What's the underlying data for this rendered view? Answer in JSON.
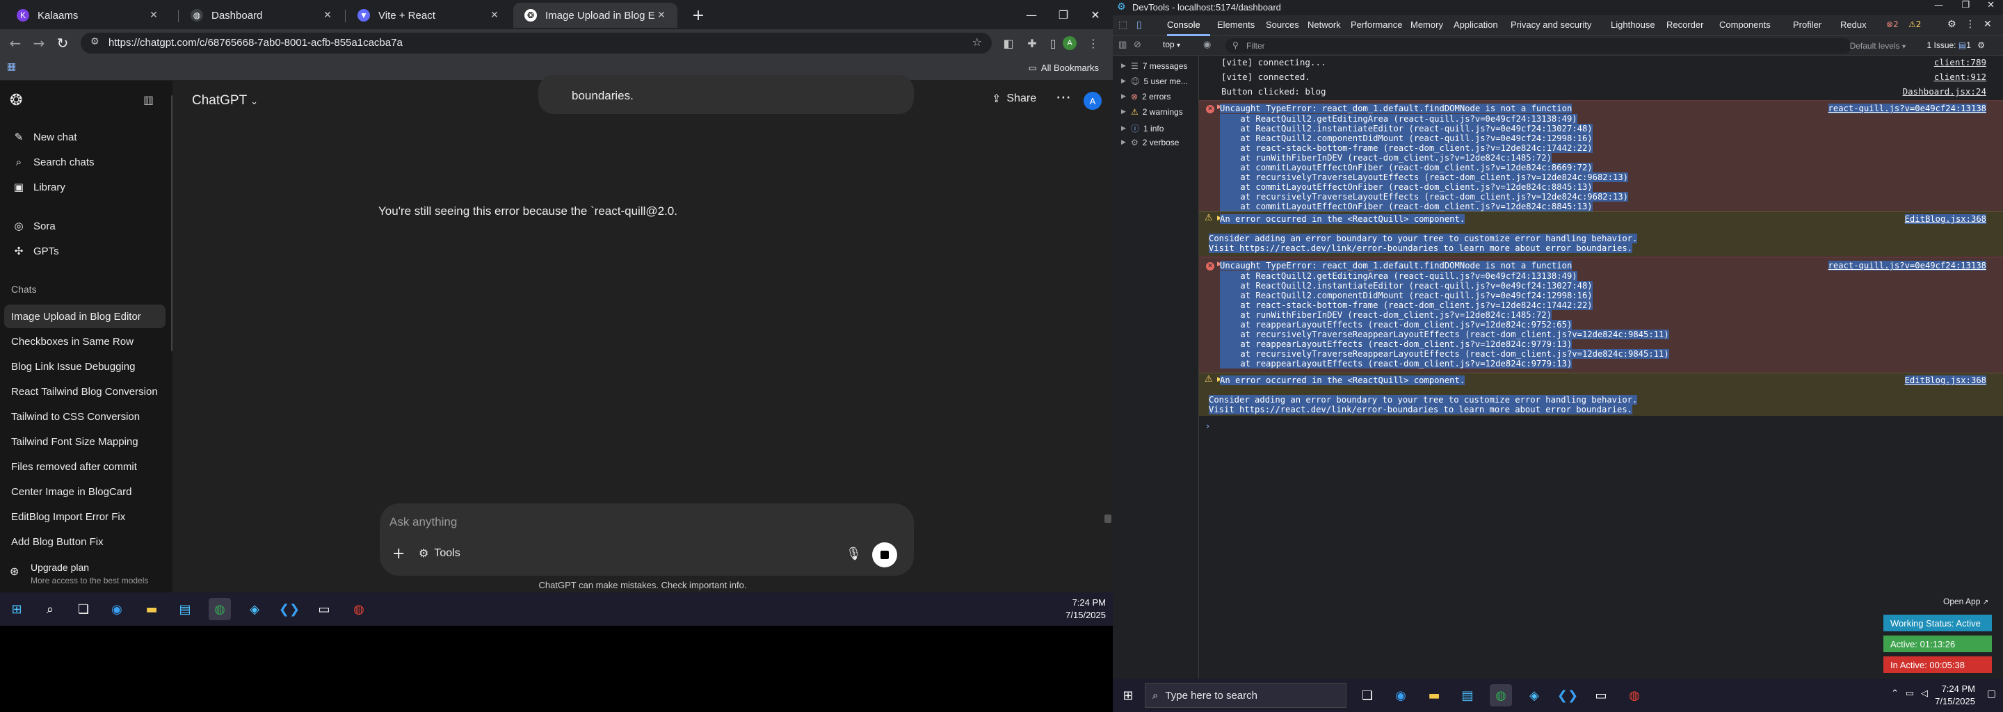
{
  "browser": {
    "tabs": [
      {
        "label": "Kalaams",
        "active": false
      },
      {
        "label": "Dashboard",
        "active": false
      },
      {
        "label": "Vite + React",
        "active": false
      },
      {
        "label": "Image Upload in Blog Editor",
        "active": true
      }
    ],
    "url": "https://chatgpt.com/c/68765668-7ab0-8001-acfb-855a1cacba7a",
    "all_bookmarks": "All Bookmarks"
  },
  "chatgpt": {
    "title": "ChatGPT",
    "share": "Share",
    "avatar_initial": "A",
    "sidebar": {
      "new_chat": "New chat",
      "search_chats": "Search chats",
      "library": "Library",
      "sora": "Sora",
      "gpts": "GPTs",
      "chats_label": "Chats",
      "chats": [
        "Image Upload in Blog Editor",
        "Checkboxes in Same Row",
        "Blog Link Issue Debugging",
        "React Tailwind Blog Conversion",
        "Tailwind to CSS Conversion",
        "Tailwind Font Size Mapping",
        "Files removed after commit",
        "Center Image in BlogCard",
        "EditBlog Import Error Fix",
        "Add Blog Button Fix"
      ],
      "upgrade_title": "Upgrade plan",
      "upgrade_sub": "More access to the best models"
    },
    "bubble_text": "boundaries.",
    "assistant_text": "You're still seeing this error because the `react-quill@2.0.",
    "composer": {
      "placeholder": "Ask anything",
      "tools": "Tools"
    },
    "disclaimer": "ChatGPT can make mistakes. Check important info."
  },
  "taskbar_left": {
    "time": "7:24 PM",
    "date": "7/15/2025"
  },
  "devtools": {
    "window_title": "DevTools - localhost:5174/dashboard",
    "tabs": [
      "Console",
      "Elements",
      "Sources",
      "Network",
      "Performance",
      "Memory",
      "Application",
      "Privacy and security",
      "Lighthouse",
      "Recorder",
      "Components",
      "Profiler",
      "Redux"
    ],
    "active_tab": "Console",
    "badge_errors": "2",
    "badge_warnings": "2",
    "context": "top",
    "filter_placeholder": "Filter",
    "levels": "Default levels",
    "issues": "1 Issue:",
    "issues_count": "1",
    "sidebar": [
      {
        "label": "7 messages",
        "icon": "list-icon"
      },
      {
        "label": "5 user me...",
        "icon": "user-icon"
      },
      {
        "label": "2 errors",
        "icon": "error-icon"
      },
      {
        "label": "2 warnings",
        "icon": "warning-icon"
      },
      {
        "label": "1 info",
        "icon": "info-icon"
      },
      {
        "label": "2 verbose",
        "icon": "verbose-icon"
      }
    ],
    "logs": [
      {
        "text": "[vite] connecting...",
        "src": "client:789"
      },
      {
        "text": "[vite] connected.",
        "src": "client:912"
      },
      {
        "text": "Button clicked: blog",
        "src": "Dashboard.jsx:24"
      }
    ],
    "error1": {
      "src": "react-quill.js?v=0e49cf24:13138",
      "lines": [
        "Uncaught TypeError: react_dom_1.default.findDOMNode is not a function",
        "    at ReactQuill2.getEditingArea (react-quill.js?v=0e49cf24:13138:49)",
        "    at ReactQuill2.instantiateEditor (react-quill.js?v=0e49cf24:13027:48)",
        "    at ReactQuill2.componentDidMount (react-quill.js?v=0e49cf24:12998:16)",
        "    at react-stack-bottom-frame (react-dom_client.js?v=12de824c:17442:22)",
        "    at runWithFiberInDEV (react-dom_client.js?v=12de824c:1485:72)",
        "    at commitLayoutEffectOnFiber (react-dom_client.js?v=12de824c:8669:72)",
        "    at recursivelyTraverseLayoutEffects (react-dom_client.js?v=12de824c:9682:13)",
        "    at commitLayoutEffectOnFiber (react-dom_client.js?v=12de824c:8845:13)",
        "    at recursivelyTraverseLayoutEffects (react-dom_client.js?v=12de824c:9682:13)",
        "    at commitLayoutEffectOnFiber (react-dom_client.js?v=12de824c:8845:13)"
      ]
    },
    "warn1": {
      "src": "EditBlog.jsx:368",
      "lines": [
        "An error occurred in the <ReactQuill> component.",
        "",
        "Consider adding an error boundary to your tree to customize error handling behavior.",
        "Visit https://react.dev/link/error-boundaries to learn more about error boundaries."
      ]
    },
    "error2": {
      "src": "react-quill.js?v=0e49cf24:13138",
      "lines": [
        "Uncaught TypeError: react_dom_1.default.findDOMNode is not a function",
        "    at ReactQuill2.getEditingArea (react-quill.js?v=0e49cf24:13138:49)",
        "    at ReactQuill2.instantiateEditor (react-quill.js?v=0e49cf24:13027:48)",
        "    at ReactQuill2.componentDidMount (react-quill.js?v=0e49cf24:12998:16)",
        "    at react-stack-bottom-frame (react-dom_client.js?v=12de824c:17442:22)",
        "    at runWithFiberInDEV (react-dom_client.js?v=12de824c:1485:72)",
        "    at reappearLayoutEffects (react-dom_client.js?v=12de824c:9752:65)",
        "    at recursivelyTraverseReappearLayoutEffects (react-dom_client.js?v=12de824c:9845:11)",
        "    at reappearLayoutEffects (react-dom_client.js?v=12de824c:9779:13)",
        "    at recursivelyTraverseReappearLayoutEffects (react-dom_client.js?v=12de824c:9845:11)",
        "    at reappearLayoutEffects (react-dom_client.js?v=12de824c:9779:13)"
      ]
    },
    "warn2": {
      "src": "EditBlog.jsx:368",
      "lines": [
        "An error occurred in the <ReactQuill> component.",
        "",
        "Consider adding an error boundary to your tree to customize error handling behavior.",
        "Visit https://react.dev/link/error-boundaries to learn more about error boundaries."
      ]
    }
  },
  "status_widget": {
    "open_app": "Open App",
    "working": "Working Status: Active",
    "active": "Active: 01:13:26",
    "inactive": "In Active: 00:05:38",
    "colors": {
      "working": "#1e8fb8",
      "active": "#3fa34d",
      "inactive": "#d0312d"
    }
  },
  "taskbar_right": {
    "search_placeholder": "Type here to search",
    "time": "7:24 PM",
    "date": "7/15/2025"
  }
}
